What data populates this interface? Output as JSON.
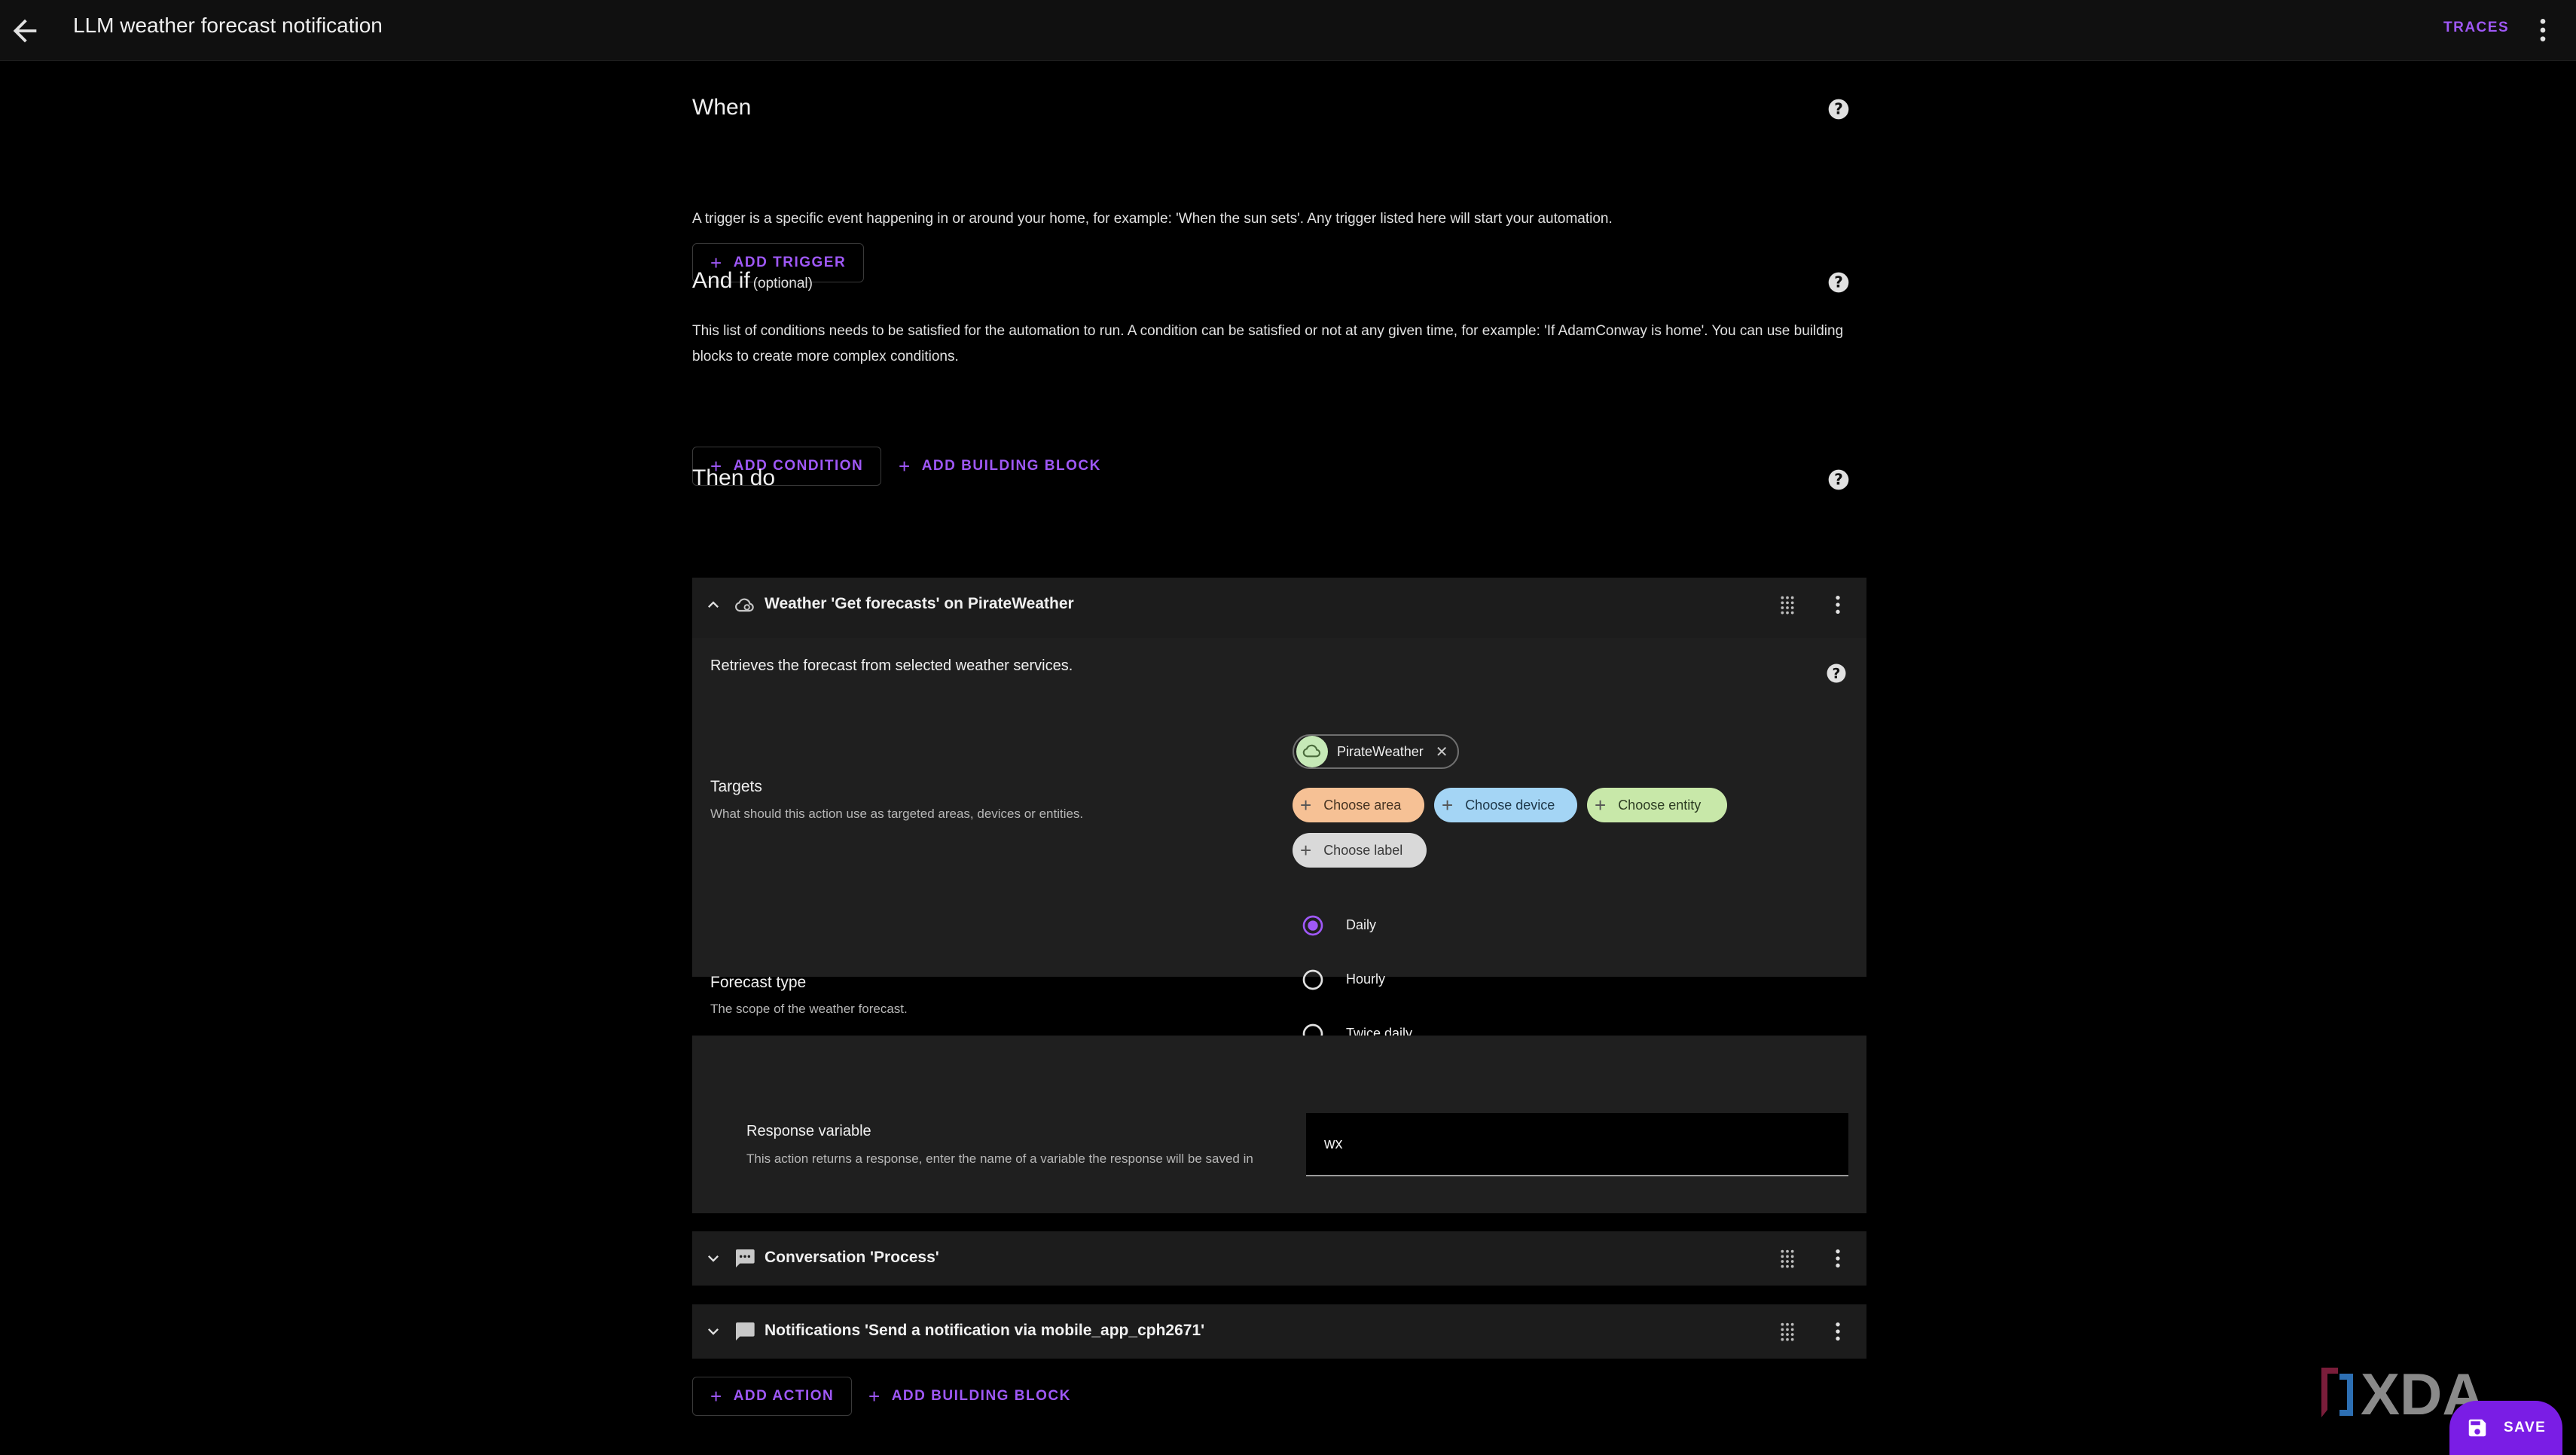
{
  "header": {
    "title": "LLM weather forecast notification",
    "traces_label": "TRACES",
    "back_icon": "arrow-left-icon",
    "menu_icon": "dots-vertical-icon"
  },
  "when": {
    "title": "When",
    "description": "A trigger is a specific event happening in or around your home, for example: 'When the sun sets'. Any trigger listed here will start your automation.",
    "add_trigger_label": "ADD TRIGGER"
  },
  "and_if": {
    "title": "And if",
    "optional_label": "(optional)",
    "description": "This list of conditions needs to be satisfied for the automation to run. A condition can be satisfied or not at any given time, for example: 'If AdamConway is home'. You can use building blocks to create more complex conditions.",
    "add_condition_label": "ADD CONDITION",
    "add_building_block_label": "ADD BUILDING BLOCK"
  },
  "then_do": {
    "title": "Then do",
    "actions": [
      {
        "title": "Weather 'Get forecasts' on PirateWeather",
        "expanded": true,
        "icon": "weather-cloud-icon",
        "description": "Retrieves the forecast from selected weather services.",
        "targets": {
          "label": "Targets",
          "sublabel": "What should this action use as targeted areas, devices or entities.",
          "selected_chip": "PirateWeather",
          "choose_area": "Choose area",
          "choose_device": "Choose device",
          "choose_entity": "Choose entity",
          "choose_label": "Choose label"
        },
        "forecast_type": {
          "label": "Forecast type",
          "sublabel": "The scope of the weather forecast.",
          "options": [
            "Daily",
            "Hourly",
            "Twice daily"
          ],
          "selected": "Daily"
        },
        "response_variable": {
          "label": "Response variable",
          "sublabel": "This action returns a response, enter the name of a variable the response will be saved in",
          "value": "wx"
        }
      },
      {
        "title": "Conversation 'Process'",
        "expanded": false,
        "icon": "message-processing-icon"
      },
      {
        "title": "Notifications 'Send a notification via mobile_app_cph2671'",
        "expanded": false,
        "icon": "message-icon"
      }
    ],
    "add_action_label": "ADD ACTION",
    "add_building_block_label": "ADD BUILDING BLOCK"
  },
  "save_label": "SAVE",
  "watermark": "XDA",
  "colors": {
    "accent": "#9f58f7",
    "fab": "#7a1de5",
    "background": "#000000",
    "card": "#1c1c1c"
  }
}
